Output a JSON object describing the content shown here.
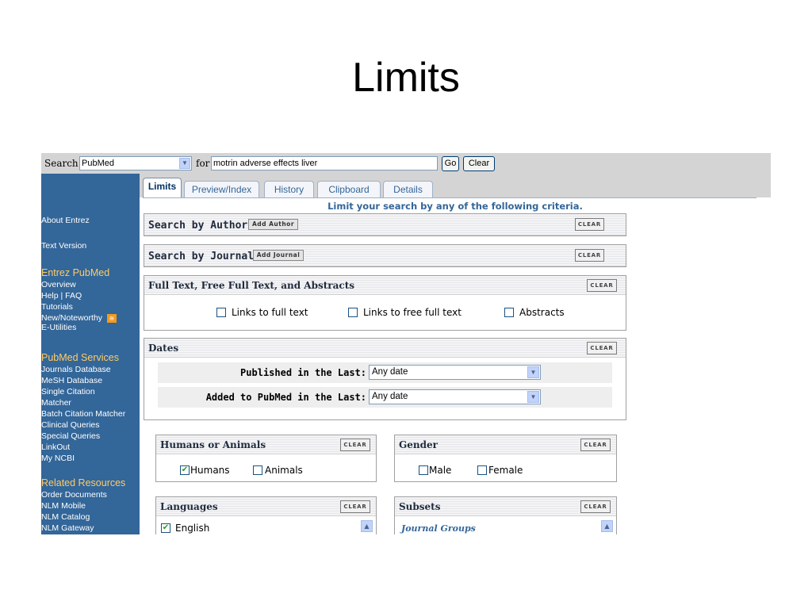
{
  "slide": {
    "title": "Limits"
  },
  "searchbar": {
    "search_label": "Search",
    "database": "PubMed",
    "for_label": "for",
    "term": "motrin adverse effects liver",
    "go_label": "Go",
    "clear_label": "Clear"
  },
  "sidebar": {
    "top_items": [
      "About Entrez",
      "Text Version"
    ],
    "sections": [
      {
        "heading": "Entrez PubMed",
        "items": [
          "Overview",
          "Help | FAQ",
          "Tutorials",
          "New/Noteworthy",
          "E-Utilities"
        ]
      },
      {
        "heading": "PubMed Services",
        "items": [
          "Journals Database",
          "MeSH Database",
          "Single Citation",
          "Matcher",
          "Batch Citation Matcher",
          "Clinical Queries",
          "Special Queries",
          "LinkOut",
          "My NCBI"
        ]
      },
      {
        "heading": "Related Resources",
        "items": [
          "Order Documents",
          "NLM Mobile",
          "NLM Catalog",
          "NLM Gateway"
        ]
      }
    ]
  },
  "tabs": [
    "Limits",
    "Preview/Index",
    "History",
    "Clipboard",
    "Details"
  ],
  "main": {
    "criteria": "Limit your search by any of the following criteria.",
    "author": {
      "title": "Search by Author",
      "add_label": "Add Author",
      "clear_label": "CLEAR"
    },
    "journal": {
      "title": "Search by Journal",
      "add_label": "Add Journal",
      "clear_label": "CLEAR"
    },
    "fulltext": {
      "title": "Full Text, Free Full Text, and Abstracts",
      "clear_label": "CLEAR",
      "options": [
        {
          "label": "Links to full text",
          "checked": false
        },
        {
          "label": "Links to free full text",
          "checked": false
        },
        {
          "label": "Abstracts",
          "checked": false
        }
      ]
    },
    "dates": {
      "title": "Dates",
      "clear_label": "CLEAR",
      "published_label": "Published in the Last:",
      "published_value": "Any date",
      "added_label": "Added to PubMed in the Last:",
      "added_value": "Any date"
    },
    "humans_animals": {
      "title": "Humans or Animals",
      "clear_label": "CLEAR",
      "options": [
        {
          "label": "Humans",
          "checked": true
        },
        {
          "label": "Animals",
          "checked": false
        }
      ]
    },
    "gender": {
      "title": "Gender",
      "clear_label": "CLEAR",
      "options": [
        {
          "label": "Male",
          "checked": false
        },
        {
          "label": "Female",
          "checked": false
        }
      ]
    },
    "languages": {
      "title": "Languages",
      "clear_label": "CLEAR",
      "first_option": {
        "label": "English",
        "checked": true
      }
    },
    "subsets": {
      "title": "Subsets",
      "clear_label": "CLEAR",
      "first_group": "Journal Groups"
    }
  },
  "colors": {
    "sidebar_bg": "#336699",
    "sidebar_heading": "#ffcc66",
    "link_blue": "#336699",
    "bar_gray": "#d4d4d4"
  }
}
